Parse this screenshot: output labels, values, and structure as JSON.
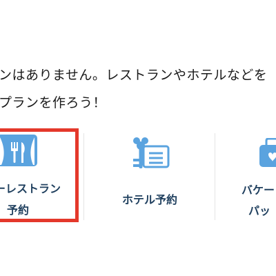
{
  "message": {
    "line1": "ンはありません。レストランやホテルなどを",
    "line2": "プランを作ろう！"
  },
  "options": [
    {
      "label_line1": "ーレストラン",
      "label_line2": "予約",
      "icon": "restaurant-icon",
      "highlighted": true
    },
    {
      "label_line1": "ホテル予約",
      "icon": "hotel-key-icon"
    },
    {
      "label_line1": "バケー",
      "label_line2": "パッ",
      "icon": "vacation-package-icon"
    }
  ],
  "colors": {
    "highlight_border": "#e4382b",
    "icon_blue": "#5aa3df",
    "label_text": "#1f3f5e"
  }
}
